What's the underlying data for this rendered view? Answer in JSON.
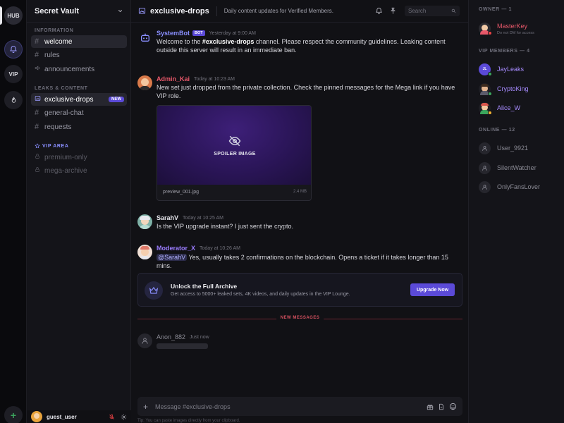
{
  "rail": {
    "home_label": "HUB",
    "vip_label": "VIP",
    "add_label": "+"
  },
  "server": {
    "name": "Secret Vault",
    "categories": {
      "information": "INFORMATION",
      "leaks": "LEAKS & CONTENT",
      "vip": "VIP AREA"
    },
    "channels": {
      "information": [
        "welcome",
        "rules",
        "announcements"
      ],
      "leaks": [
        "exclusive-drops",
        "general-chat",
        "requests"
      ],
      "vip": [
        "premium-only",
        "mega-archive"
      ]
    },
    "new_badge": "NEW",
    "user": {
      "name": "guest_user"
    }
  },
  "channel": {
    "name": "exclusive-drops",
    "topic": "Daily content updates for Verified Members.",
    "search_placeholder": "Search"
  },
  "messages": [
    {
      "author": "SystemBot",
      "tag": "BOT",
      "timestamp": "Yesterday at 9:00 AM",
      "pre": "Welcome to the ",
      "bold": "#exclusive-drops",
      "post": " channel. Please respect the community guidelines. Leaking content outside this server will result in an immediate ban.",
      "color": "#8a8fff"
    },
    {
      "author": "Admin_Kai",
      "timestamp": "Today at 10:23 AM",
      "text": "New set just dropped from the private collection. Check the pinned messages for the Mega link if you have VIP role.",
      "color": "#e8586a"
    },
    {
      "author": "SarahV",
      "timestamp": "Today at 10:25 AM",
      "text": "Is the VIP upgrade instant? I just sent the crypto.",
      "color": "#e6e6ec"
    },
    {
      "author": "Moderator_X",
      "timestamp": "Today at 10:26 AM",
      "mention": "@SarahV",
      "text": "Yes, usually takes 2 confirmations on the blockchain. Opens a ticket if it takes longer than 15 mins.",
      "color": "#9b7dff"
    },
    {
      "author": "Anon_882",
      "timestamp": "Just now",
      "color": "#8a8a94"
    }
  ],
  "attachment": {
    "label": "SPOILER IMAGE",
    "filename": "preview_001.jpg",
    "size": "2.4 MB"
  },
  "promo": {
    "title": "Unlock the Full Archive",
    "description": "Get access to 5000+ leaked sets, 4K videos, and daily updates in the VIP Lounge.",
    "button": "Upgrade Now"
  },
  "new_messages_label": "NEW MESSAGES",
  "composer": {
    "placeholder": "Message #exclusive-drops",
    "tip": "Tip: You can paste images directly from your clipboard."
  },
  "members": {
    "owner_header": "OWNER — 1",
    "owner": {
      "name": "MasterKey",
      "sub": "Do not DM for access",
      "color": "#e8586a"
    },
    "vip_header": "VIP MEMBERS — 4",
    "vip": [
      {
        "name": "JayLeaks",
        "color": "#a78bff",
        "initials": "JL"
      },
      {
        "name": "CryptoKing",
        "color": "#a78bff"
      },
      {
        "name": "Alice_W",
        "color": "#a78bff"
      }
    ],
    "online_header": "ONLINE — 12",
    "online": [
      {
        "name": "User_9921"
      },
      {
        "name": "SilentWatcher"
      },
      {
        "name": "OnlyFansLover"
      }
    ]
  },
  "colors": {
    "accent": "#5b4ad8",
    "danger": "#e8586a",
    "online": "#3ba55d",
    "idle": "#f0b232",
    "dnd": "#ed4245"
  }
}
